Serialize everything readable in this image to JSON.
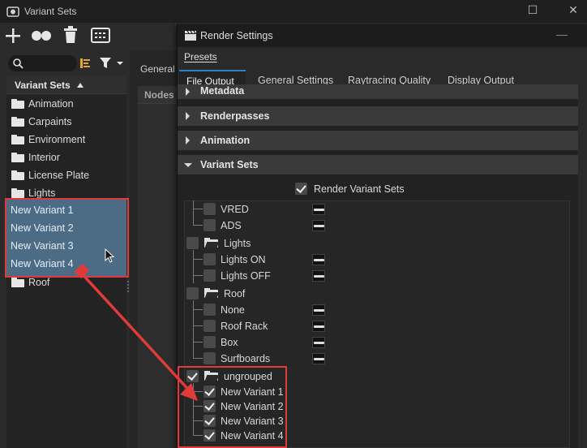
{
  "variant_sets_window": {
    "title": "Variant Sets",
    "toolbar_icons": [
      "plus-icon",
      "link-icon",
      "trash-icon",
      "dashboard-icon"
    ],
    "filter_icons": [
      "search-icon",
      "sort-icon",
      "filter-icon"
    ],
    "tree_header": "Variant Sets",
    "tree_items": [
      "Animation",
      "Carpaints",
      "Environment",
      "Interior",
      "License Plate",
      "Lights"
    ],
    "selected_items": [
      "New Variant 1",
      "New Variant 2",
      "New Variant 3",
      "New Variant 4"
    ],
    "after_item": "Roof",
    "mid_tab": "General",
    "mid_header": "Nodes"
  },
  "render_settings": {
    "title": "Render Settings",
    "menu": "Presets",
    "tabs": [
      "File Output",
      "General Settings",
      "Raytracing Quality",
      "Display Output"
    ],
    "active_tab": "File Output",
    "sections": {
      "metadata": "Metadata",
      "renderpasses": "Renderpasses",
      "animation": "Animation",
      "variant_sets": "Variant Sets"
    },
    "render_variant_sets_label": "Render Variant Sets",
    "render_variant_sets_checked": true,
    "rows": {
      "vred": "VRED",
      "ads": "ADS",
      "lights": "Lights",
      "lights_on": "Lights ON",
      "lights_off": "Lights OFF",
      "roof": "Roof",
      "none": "None",
      "roof_rack": "Roof Rack",
      "box": "Box",
      "surfboards": "Surfboards",
      "ungrouped": "ungrouped",
      "nv1": "New Variant 1",
      "nv2": "New Variant 2",
      "nv3": "New Variant 3",
      "nv4": "New Variant 4"
    }
  },
  "colors": {
    "selection": "#4c6c86",
    "highlight_red": "#e03a3a",
    "active_tab_accent": "#2f7fc4"
  }
}
